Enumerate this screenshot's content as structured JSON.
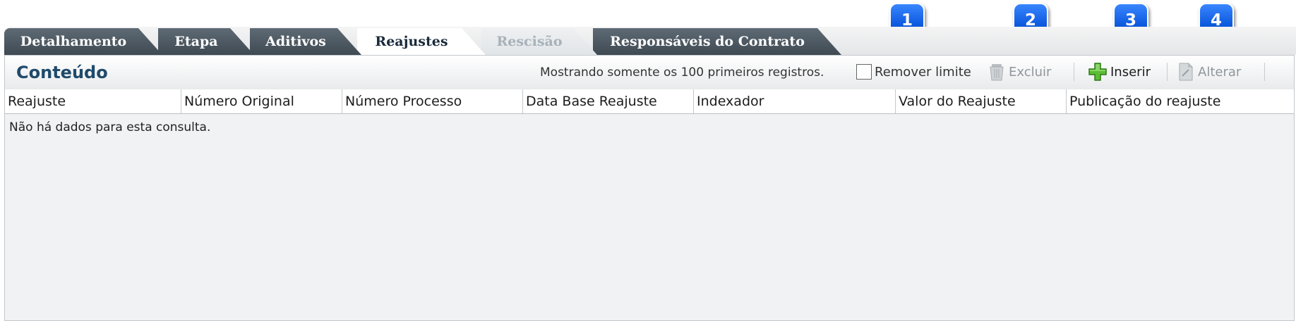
{
  "callouts": [
    "1",
    "2",
    "3",
    "4"
  ],
  "tabs": [
    {
      "label": "Detalhamento",
      "state": "normal"
    },
    {
      "label": "Etapa",
      "state": "normal"
    },
    {
      "label": "Aditivos",
      "state": "normal"
    },
    {
      "label": "Reajustes",
      "state": "active"
    },
    {
      "label": "Rescisão",
      "state": "disabled"
    },
    {
      "label": "Responsáveis do Contrato",
      "state": "normal"
    }
  ],
  "panel": {
    "title": "Conteúdo",
    "info_text": "Mostrando somente os 100 primeiros registros.",
    "remove_limit_label": "Remover limite",
    "remove_limit_checked": false
  },
  "toolbar": {
    "delete_label": "Excluir",
    "delete_icon": "trash-icon",
    "insert_label": "Inserir",
    "insert_icon": "plus-icon",
    "edit_label": "Alterar",
    "edit_icon": "edit-document-icon"
  },
  "table": {
    "columns": [
      "Reajuste",
      "Número Original",
      "Número Processo",
      "Data Base Reajuste",
      "Indexador",
      "Valor do Reajuste",
      "Publicação do reajuste"
    ],
    "empty_message": "Não há dados para esta consulta."
  },
  "colors": {
    "callout": "#0f5ce0",
    "tab_dark": "#4a555e",
    "panel_title": "#1f4a6b",
    "insert_green": "#4caf2a"
  }
}
